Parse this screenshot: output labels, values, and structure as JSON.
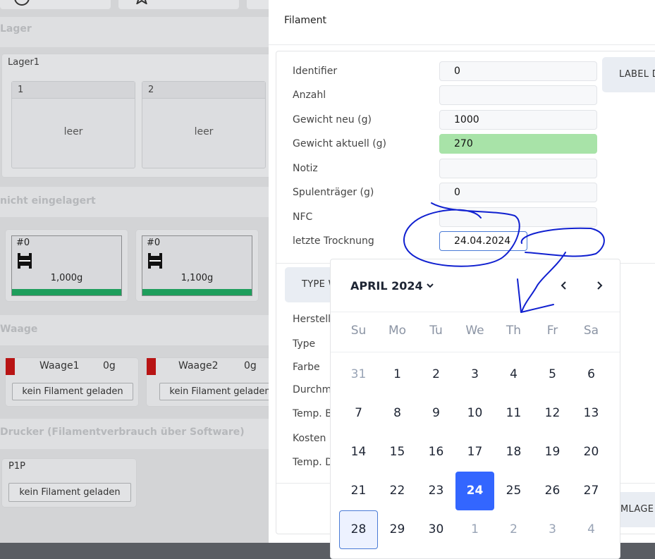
{
  "background": {
    "sections": {
      "lager": "Lager",
      "nicht_eingelagert": "nicht eingelagert",
      "waage": "Waage",
      "drucker": "Drucker (Filamentverbrauch über Software)"
    },
    "lager1": {
      "title": "Lager1",
      "slots": [
        {
          "id": "1",
          "status": "leer"
        },
        {
          "id": "2",
          "status": "leer"
        }
      ]
    },
    "spools": [
      {
        "id": "#0",
        "weight": "1,000g"
      },
      {
        "id": "#0",
        "weight": "1,100g"
      }
    ],
    "scales": [
      {
        "name": "Waage1",
        "value": "0g",
        "button": "kein Filament geladen"
      },
      {
        "name": "Waage2",
        "value": "0g",
        "button": "kein Filament geladen"
      }
    ],
    "printer": {
      "name": "P1P",
      "button": "kein Filament geladen"
    }
  },
  "modal": {
    "title": "Filament",
    "label_button": "LABEL D",
    "type_button": "TYPE W",
    "bottom_right_button": "MLAGE",
    "fields": [
      {
        "label": "Identifier",
        "value": "0"
      },
      {
        "label": "Anzahl",
        "value": ""
      },
      {
        "label": "Gewicht neu (g)",
        "value": "1000"
      },
      {
        "label": "Gewicht aktuell (g)",
        "value": "270"
      },
      {
        "label": "Notiz",
        "value": ""
      },
      {
        "label": "Spulenträger (g)",
        "value": "0"
      },
      {
        "label": "NFC",
        "value": ""
      },
      {
        "label": "letzte Trocknung",
        "value": "24.04.2024"
      }
    ],
    "lower_labels": [
      "Herstelle",
      "Type",
      "Farbe",
      "Durchme",
      "Temp. Be",
      "Kosten",
      "Temp. Du"
    ]
  },
  "datepicker": {
    "month_label": "APRIL 2024",
    "weekdays": [
      "Su",
      "Mo",
      "Tu",
      "We",
      "Th",
      "Fr",
      "Sa"
    ],
    "weeks": [
      [
        "31",
        "1",
        "2",
        "3",
        "4",
        "5",
        "6"
      ],
      [
        "7",
        "8",
        "9",
        "10",
        "11",
        "12",
        "13"
      ],
      [
        "14",
        "15",
        "16",
        "17",
        "18",
        "19",
        "20"
      ],
      [
        "21",
        "22",
        "23",
        "24",
        "25",
        "26",
        "27"
      ],
      [
        "28",
        "29",
        "30",
        "1",
        "2",
        "3",
        "4"
      ]
    ],
    "selected_day": "24",
    "today_day": "28"
  },
  "colors": {
    "accent": "#3366ff",
    "green_field": "#a8e3a8",
    "spool_bar": "#1e9e5c",
    "scale_indicator": "#b81414",
    "annotation_ink": "#1020d0"
  }
}
